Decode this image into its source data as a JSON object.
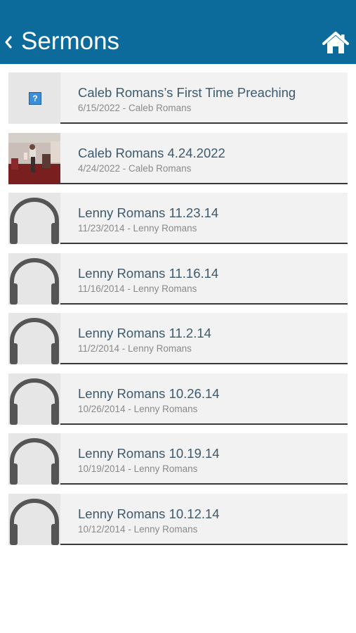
{
  "header": {
    "title": "Sermons",
    "background": "#0d6b9c",
    "back_icon": "chevron-left-icon",
    "home_icon": "home-icon"
  },
  "sermons": [
    {
      "title": "Caleb Romans’s First Time Preaching",
      "date": "6/15/2022",
      "speaker": "Caleb Romans",
      "meta": "6/15/2022 - Caleb Romans",
      "thumb": "missing-image-icon"
    },
    {
      "title": "Caleb Romans 4.24.2022",
      "date": "4/24/2022",
      "speaker": "Caleb Romans",
      "meta": "4/24/2022 - Caleb Romans",
      "thumb": "photo"
    },
    {
      "title": "Lenny Romans 11.23.14",
      "date": "11/23/2014",
      "speaker": "Lenny Romans",
      "meta": "11/23/2014 - Lenny Romans",
      "thumb": "headphones-icon"
    },
    {
      "title": "Lenny Romans 11.16.14",
      "date": "11/16/2014",
      "speaker": "Lenny Romans",
      "meta": "11/16/2014 - Lenny Romans",
      "thumb": "headphones-icon"
    },
    {
      "title": "Lenny Romans 11.2.14",
      "date": "11/2/2014",
      "speaker": "Lenny Romans",
      "meta": "11/2/2014 - Lenny Romans",
      "thumb": "headphones-icon"
    },
    {
      "title": "Lenny Romans 10.26.14",
      "date": "10/26/2014",
      "speaker": "Lenny Romans",
      "meta": "10/26/2014 - Lenny Romans",
      "thumb": "headphones-icon"
    },
    {
      "title": "Lenny Romans 10.19.14",
      "date": "10/19/2014",
      "speaker": "Lenny Romans",
      "meta": "10/19/2014 - Lenny Romans",
      "thumb": "headphones-icon"
    },
    {
      "title": "Lenny Romans 10.12.14",
      "date": "10/12/2014",
      "speaker": "Lenny Romans",
      "meta": "10/12/2014 - Lenny Romans",
      "thumb": "headphones-icon"
    }
  ]
}
